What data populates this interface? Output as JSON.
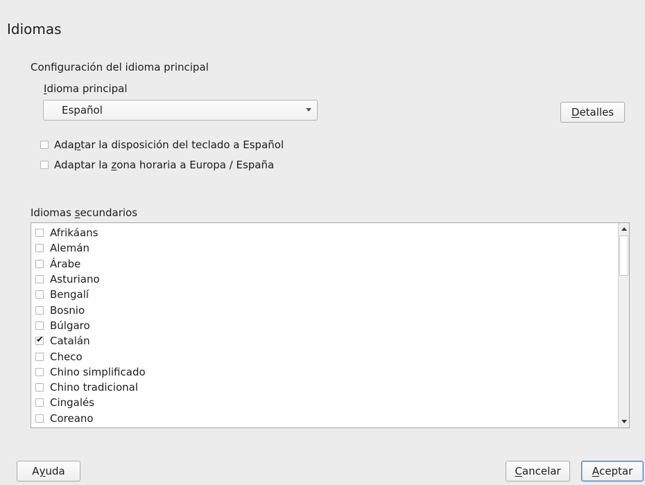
{
  "dialog": {
    "title": "Idiomas"
  },
  "primary": {
    "section_label": "Configuración del idioma principal",
    "language_label_u": "I",
    "language_label_rest": "dioma principal",
    "selected_language": "Español",
    "details_button_u": "D",
    "details_button_rest": "etalles",
    "adapt_keyboard_a": "Ada",
    "adapt_keyboard_u": "p",
    "adapt_keyboard_b": "tar la disposición del teclado a Español",
    "adapt_keyboard_checked": false,
    "adapt_timezone_a": "Adaptar la ",
    "adapt_timezone_u": "z",
    "adapt_timezone_b": "ona horaria a Europa / España",
    "adapt_timezone_checked": false
  },
  "secondary": {
    "label_a": "Idiomas ",
    "label_u": "s",
    "label_b": "ecundarios",
    "languages": [
      {
        "name": "Afrikáans",
        "checked": false
      },
      {
        "name": "Alemán",
        "checked": false
      },
      {
        "name": "Árabe",
        "checked": false
      },
      {
        "name": "Asturiano",
        "checked": false
      },
      {
        "name": "Bengalí",
        "checked": false
      },
      {
        "name": "Bosnio",
        "checked": false
      },
      {
        "name": "Búlgaro",
        "checked": false
      },
      {
        "name": "Catalán",
        "checked": true
      },
      {
        "name": "Checo",
        "checked": false
      },
      {
        "name": "Chino simplificado",
        "checked": false
      },
      {
        "name": "Chino tradicional",
        "checked": false
      },
      {
        "name": "Cingalés",
        "checked": false
      },
      {
        "name": "Coreano",
        "checked": false
      }
    ]
  },
  "footer": {
    "help_a": "A",
    "help_u": "y",
    "help_b": "uda",
    "cancel_u": "C",
    "cancel_rest": "ancelar",
    "accept_u": "A",
    "accept_rest": "ceptar"
  },
  "icons": {
    "check": "✔"
  }
}
